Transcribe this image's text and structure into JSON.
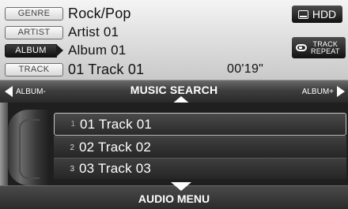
{
  "info": {
    "genre": {
      "tag": "GENRE",
      "value": "Rock/Pop"
    },
    "artist": {
      "tag": "ARTIST",
      "value": "Artist 01"
    },
    "album": {
      "tag": "ALBUM",
      "value": "Album 01"
    },
    "track": {
      "tag": "TRACK",
      "value": "01 Track 01"
    },
    "elapsed_time": "00'19\""
  },
  "buttons": {
    "hdd_label": "HDD",
    "track_repeat_line1": "TRACK",
    "track_repeat_line2": "REPEAT"
  },
  "search_bar": {
    "album_prev": "ALBUM-",
    "title": "MUSIC SEARCH",
    "album_next": "ALBUM+"
  },
  "tracks": [
    {
      "num": "1",
      "name": "01 Track 01",
      "selected": true
    },
    {
      "num": "2",
      "name": "02 Track 02",
      "selected": false
    },
    {
      "num": "3",
      "name": "03 Track 03",
      "selected": false
    }
  ],
  "bottom": {
    "audio_menu": "AUDIO MENU"
  },
  "icons": {
    "hdd": "hdd-icon",
    "repeat": "repeat-icon",
    "left": "triangle-left-icon",
    "right": "triangle-right-icon",
    "up": "scroll-up-icon",
    "down": "scroll-down-icon"
  },
  "colors": {
    "panel_light": "#e6e6e6",
    "panel_dark": "#1e1e1e",
    "text_dark": "#111111",
    "text_light": "#ffffff"
  }
}
